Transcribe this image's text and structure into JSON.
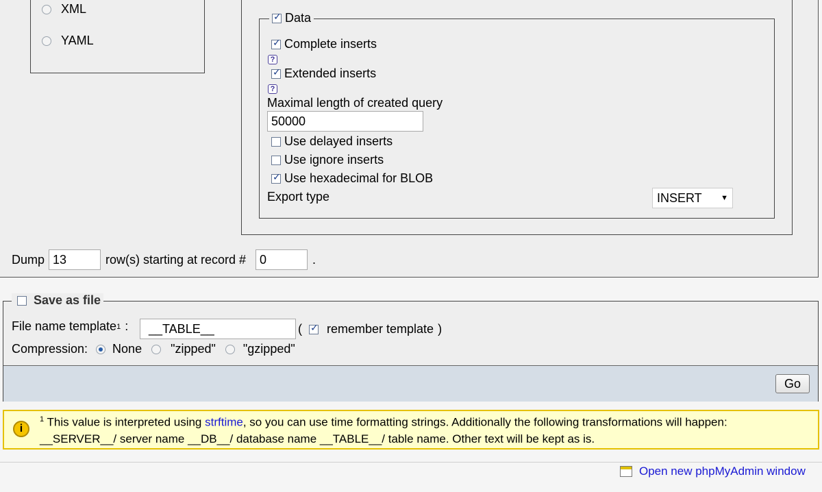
{
  "format_options": [
    {
      "label": "XML",
      "selected": false
    },
    {
      "label": "YAML",
      "selected": false
    }
  ],
  "data_section": {
    "legend": "Data",
    "checked": true,
    "complete_inserts": {
      "label": "Complete inserts",
      "checked": true
    },
    "extended_inserts": {
      "label": "Extended inserts",
      "checked": true
    },
    "help_icon_glyph": "?",
    "max_query_label": "Maximal length of created query",
    "max_query_value": "50000",
    "delayed_inserts": {
      "label": "Use delayed inserts",
      "checked": false
    },
    "ignore_inserts": {
      "label": "Use ignore inserts",
      "checked": false
    },
    "hex_blob": {
      "label": "Use hexadecimal for BLOB",
      "checked": true
    },
    "export_type_label": "Export type",
    "export_type_value": "INSERT"
  },
  "dump": {
    "label": "Dump",
    "rows": "13",
    "middle_label": "row(s) starting at record #",
    "start": "0",
    "end": "."
  },
  "save_file": {
    "legend": "Save as file",
    "checked": false,
    "template_label": "File name template",
    "template_sup": "1",
    "template_colon": ":",
    "template_value": "__TABLE__",
    "remember_open": "(",
    "remember_label": "remember template",
    "remember_close": ")",
    "remember_checked": true,
    "compression_label": "Compression:",
    "compression_options": [
      {
        "label": "None",
        "selected": true
      },
      {
        "label": "\"zipped\"",
        "selected": false
      },
      {
        "label": "\"gzipped\"",
        "selected": false
      }
    ]
  },
  "go_button": "Go",
  "notice": {
    "icon_glyph": "i",
    "sup": "1",
    "text_before": "This value is interpreted using",
    "link": "strftime",
    "text_after": ", so you can use time formatting strings. Additionally the following transformations will happen:",
    "line2": "__SERVER__/ server name __DB__/ database name __TABLE__/ table name. Other text will be kept as is."
  },
  "footer_link": "Open new phpMyAdmin window",
  "colors": {
    "panel_bg": "#eeeeee",
    "button_bar_bg": "#d5dde6",
    "notice_bg": "#ffffcc",
    "notice_border": "#e5c100",
    "link": "#1a1ad4"
  }
}
